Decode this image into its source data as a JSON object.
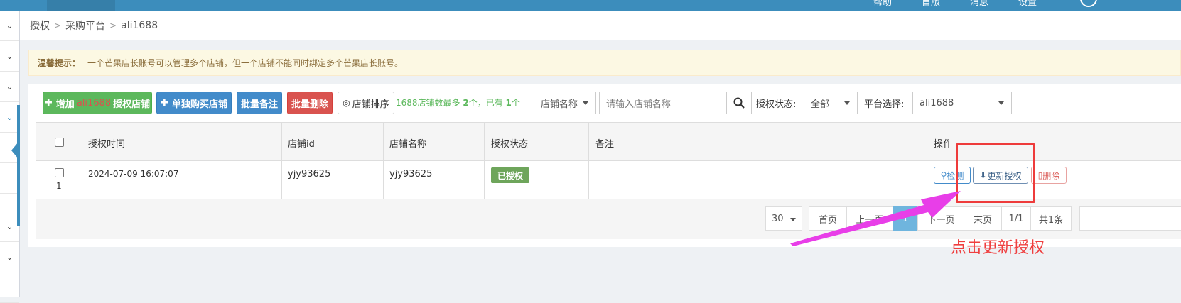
{
  "topnav": {
    "items": [
      "帮助",
      "首版",
      "消息",
      "设置"
    ]
  },
  "breadcrumb": {
    "item1": "授权",
    "item2": "采购平台",
    "item3": "ali1688"
  },
  "tip": {
    "label": "温馨提示：",
    "text": "一个芒果店长账号可以管理多个店铺，但一个店铺不能同时绑定多个芒果店长账号。"
  },
  "toolbar": {
    "add_prefix": "增加",
    "add_platform": "ali1688",
    "add_suffix": "授权店铺",
    "buy_only": "单独购买店铺",
    "batch_note": "批量备注",
    "batch_delete": "批量删除",
    "sort": "店铺排序",
    "info_a": "1688店铺数最多 ",
    "info_max": "2",
    "info_b": "个，已有 ",
    "info_have": "1",
    "info_c": "个",
    "search_field": "店铺名称",
    "search_placeholder": "请输入店铺名称",
    "auth_status_label": "授权状态:",
    "auth_status_value": "全部",
    "platform_label": "平台选择:",
    "platform_value": "ali1688"
  },
  "table": {
    "headers": {
      "time": "授权时间",
      "shop_id": "店铺id",
      "shop_name": "店铺名称",
      "status": "授权状态",
      "note": "备注",
      "ops": "操作"
    },
    "rows": [
      {
        "index": "1",
        "time": "2024-07-09 16:07:07",
        "shop_id": "yjy93625",
        "shop_name": "yjy93625",
        "status": "已授权",
        "note": "",
        "op_check": "检测",
        "op_update": "更新授权",
        "op_delete": "删除"
      }
    ]
  },
  "pager": {
    "page_size": "30",
    "first": "首页",
    "prev": "上一页",
    "current": "1",
    "next": "下一页",
    "last": "末页",
    "pages": "1/1",
    "total": "共1条"
  },
  "annotation": {
    "text": "点击更新授权"
  },
  "colors": {
    "primary": "#3c8dbc",
    "success": "#5cb85c",
    "danger": "#d9534f",
    "highlight": "#ee3b3b",
    "arrow": "#e83ee8"
  }
}
